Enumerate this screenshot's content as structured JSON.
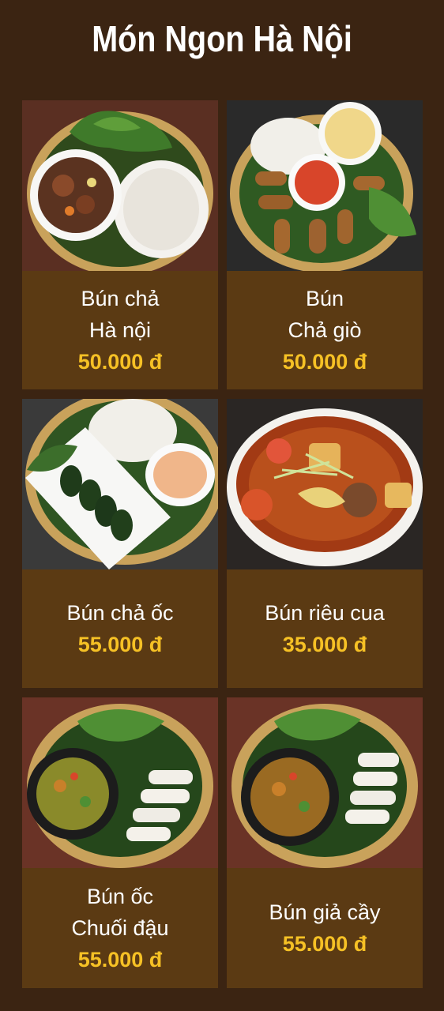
{
  "header": {
    "title": "Món Ngon Hà Nội"
  },
  "menu": {
    "items": [
      {
        "name_lines": [
          "Bún chả",
          "Hà nội"
        ],
        "price": "50.000 đ"
      },
      {
        "name_lines": [
          "Bún",
          "Chả giò"
        ],
        "price": "50.000 đ"
      },
      {
        "name_lines": [
          "Bún chả ốc"
        ],
        "price": "55.000 đ"
      },
      {
        "name_lines": [
          "Bún riêu cua"
        ],
        "price": "35.000 đ"
      },
      {
        "name_lines": [
          "Bún ốc",
          "Chuối đậu"
        ],
        "price": "55.000 đ"
      },
      {
        "name_lines": [
          "Bún giả cầy"
        ],
        "price": "55.000 đ"
      }
    ]
  },
  "colors": {
    "page_background": "#3b2412",
    "card_background": "#5b3a13",
    "price_color": "#f6c125",
    "title_color": "#ffffff"
  }
}
